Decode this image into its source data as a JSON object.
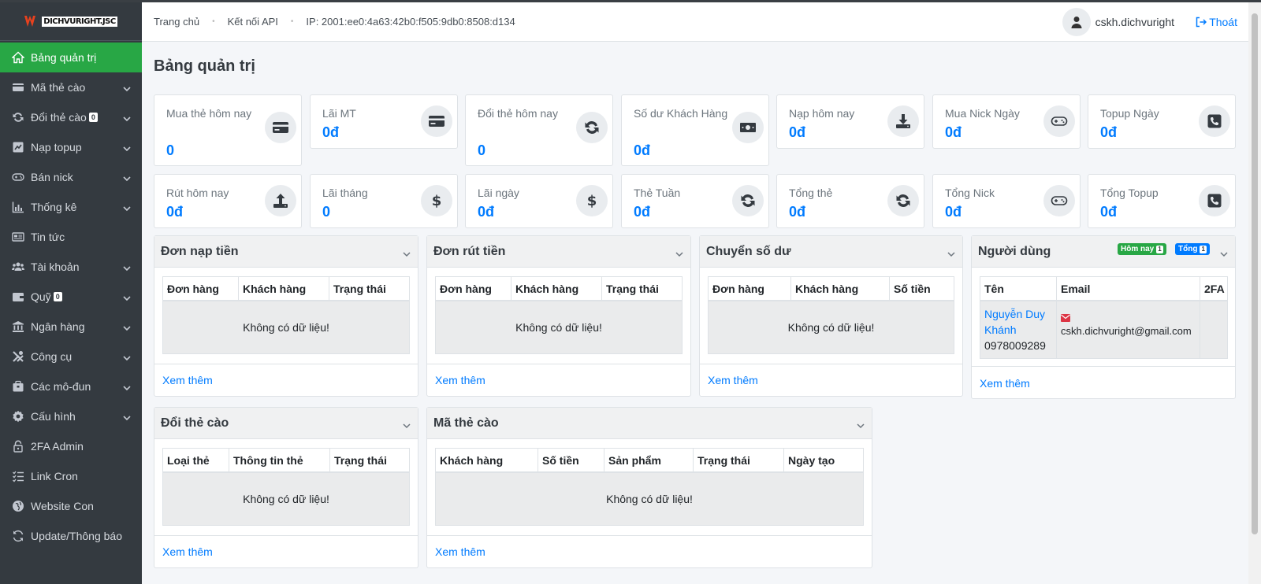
{
  "brand": {
    "name": "DICHVURIGHT.JSC"
  },
  "sidebar": {
    "items": [
      {
        "label": "Bảng quản trị",
        "icon": "home-icon",
        "active": true
      },
      {
        "label": "Mã thẻ cào",
        "icon": "card-icon",
        "chevron": true
      },
      {
        "label": "Đổi thẻ cào",
        "icon": "sync-icon",
        "chevron": true,
        "badge": "0"
      },
      {
        "label": "Nạp topup",
        "icon": "topup-icon",
        "chevron": true
      },
      {
        "label": "Bán nick",
        "icon": "gamepad-icon",
        "chevron": true
      },
      {
        "label": "Thống kê",
        "icon": "chart-icon",
        "chevron": true
      },
      {
        "label": "Tin tức",
        "icon": "news-icon"
      },
      {
        "label": "Tài khoản",
        "icon": "users-icon",
        "chevron": true
      },
      {
        "label": "Quỹ",
        "icon": "wallet-icon",
        "chevron": true,
        "badge": "0"
      },
      {
        "label": "Ngân hàng",
        "icon": "bank-icon",
        "chevron": true
      },
      {
        "label": "Công cụ",
        "icon": "tools-icon",
        "chevron": true
      },
      {
        "label": "Các mô-đun",
        "icon": "modules-icon",
        "chevron": true
      },
      {
        "label": "Cấu hình",
        "icon": "gear-icon",
        "chevron": true
      },
      {
        "label": "2FA Admin",
        "icon": "lock-icon"
      },
      {
        "label": "Link Cron",
        "icon": "list-icon"
      },
      {
        "label": "Website Con",
        "icon": "globe-icon"
      },
      {
        "label": "Update/Thông báo",
        "icon": "refresh-icon"
      }
    ]
  },
  "topbar": {
    "home": "Trang chủ",
    "api": "Kết nối API",
    "ip": "IP: 2001:ee0:4a63:42b0:f505:9db0:8508:d134",
    "username": "cskh.dichvuright",
    "logout": "Thoát"
  },
  "page": {
    "title": "Bảng quản trị"
  },
  "stats_row1": [
    {
      "label": "Mua thẻ hôm nay",
      "value": "0",
      "icon": "credit-card-icon"
    },
    {
      "label": "Lãi MT",
      "value": "0đ",
      "icon": "credit-card-icon"
    },
    {
      "label": "Đổi thẻ hôm nay",
      "value": "0",
      "icon": "sync-icon"
    },
    {
      "label": "Số dư Khách Hàng",
      "value": "0đ",
      "icon": "money-bill-icon"
    },
    {
      "label": "Nạp hôm nay",
      "value": "0đ",
      "icon": "download-icon"
    },
    {
      "label": "Mua Nick Ngày",
      "value": "0đ",
      "icon": "gamepad-icon"
    },
    {
      "label": "Topup Ngày",
      "value": "0đ",
      "icon": "phone-icon"
    }
  ],
  "stats_row2": [
    {
      "label": "Rút hôm nay",
      "value": "0đ",
      "icon": "upload-icon"
    },
    {
      "label": "Lãi tháng",
      "value": "0",
      "icon": "dollar-icon"
    },
    {
      "label": "Lãi ngày",
      "value": "0đ",
      "icon": "dollar-icon"
    },
    {
      "label": "Thẻ Tuần",
      "value": "0đ",
      "icon": "sync-icon"
    },
    {
      "label": "Tổng thẻ",
      "value": "0đ",
      "icon": "sync-icon"
    },
    {
      "label": "Tổng Nick",
      "value": "0đ",
      "icon": "gamepad-icon"
    },
    {
      "label": "Tổng Topup",
      "value": "0đ",
      "icon": "phone-icon"
    }
  ],
  "cards": {
    "deposit": {
      "title": "Đơn nạp tiền",
      "columns": [
        "Đơn hàng",
        "Khách hàng",
        "Trạng thái"
      ],
      "empty": "Không có dữ liệu!",
      "more": "Xem thêm"
    },
    "withdraw": {
      "title": "Đơn rút tiền",
      "columns": [
        "Đơn hàng",
        "Khách hàng",
        "Trạng thái"
      ],
      "empty": "Không có dữ liệu!",
      "more": "Xem thêm"
    },
    "transfer": {
      "title": "Chuyển số dư",
      "columns": [
        "Đơn hàng",
        "Khách hàng",
        "Số tiền"
      ],
      "empty": "Không có dữ liệu!",
      "more": "Xem thêm"
    },
    "users": {
      "title": "Người dùng",
      "badge_today": "Hôm nay",
      "badge_today_count": "1",
      "badge_total": "Tổng",
      "badge_total_count": "1",
      "columns": [
        "Tên",
        "Email",
        "2FA"
      ],
      "rows": [
        {
          "name": "Nguyễn Duy Khánh",
          "phone": "0978009289",
          "email": "cskh.dichvuright@gmail.com",
          "twofa": ""
        }
      ],
      "more": "Xem thêm"
    },
    "exchange": {
      "title": "Đổi thẻ cào",
      "columns": [
        "Loại thẻ",
        "Thông tin thẻ",
        "Trạng thái"
      ],
      "empty": "Không có dữ liệu!",
      "more": "Xem thêm"
    },
    "cardcodes": {
      "title": "Mã thẻ cào",
      "columns": [
        "Khách hàng",
        "Số tiền",
        "Sản phẩm",
        "Trạng thái",
        "Ngày tạo"
      ],
      "empty": "Không có dữ liệu!",
      "more": "Xem thêm"
    }
  },
  "colors": {
    "sidebar": "#343a40",
    "active": "#28a745",
    "accent": "#007bff",
    "danger": "#dc3545"
  }
}
